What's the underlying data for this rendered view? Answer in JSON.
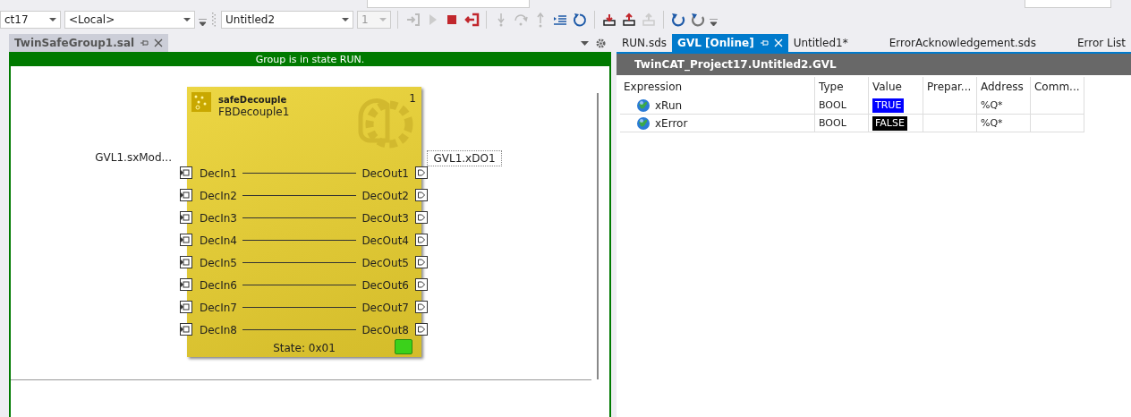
{
  "toolbar": {
    "combos": [
      {
        "value": "ct17",
        "disabled": false
      },
      {
        "value": "<Local>",
        "disabled": false
      },
      {
        "value": "Untitled2",
        "disabled": false
      },
      {
        "value": "1",
        "disabled": true
      }
    ]
  },
  "left_panel": {
    "tab": {
      "label": "TwinSafeGroup1.sal",
      "selected": true
    },
    "status": "Group is in state RUN.",
    "block": {
      "type": "safeDecouple",
      "instance": "FBDecouple1",
      "number": "1",
      "state": "State: 0x01",
      "inputs": [
        {
          "label": "DecIn1",
          "connection": "GVL1.sxMod..."
        },
        {
          "label": "DecIn2"
        },
        {
          "label": "DecIn3"
        },
        {
          "label": "DecIn4"
        },
        {
          "label": "DecIn5"
        },
        {
          "label": "DecIn6"
        },
        {
          "label": "DecIn7"
        },
        {
          "label": "DecIn8"
        }
      ],
      "outputs": [
        {
          "label": "DecOut1",
          "connection": "GVL1.xDO1"
        },
        {
          "label": "DecOut2"
        },
        {
          "label": "DecOut3"
        },
        {
          "label": "DecOut4"
        },
        {
          "label": "DecOut5"
        },
        {
          "label": "DecOut6"
        },
        {
          "label": "DecOut7"
        },
        {
          "label": "DecOut8"
        }
      ]
    }
  },
  "right_panel": {
    "tabs": [
      {
        "label": "RUN.sds",
        "selected": false
      },
      {
        "label": "GVL [Online]",
        "selected": true
      },
      {
        "label": "Untitled1*",
        "selected": false
      },
      {
        "label": "ErrorAcknowledgement.sds",
        "selected": false
      },
      {
        "label": "Error List",
        "selected": false
      }
    ],
    "header": "TwinCAT_Project17.Untitled2.GVL",
    "table": {
      "columns": [
        "Expression",
        "Type",
        "Value",
        "Prepar...",
        "Address",
        "Comm..."
      ],
      "rows": [
        {
          "expression": "xRun",
          "type": "BOOL",
          "value": "TRUE",
          "color": "#0000ff",
          "address": "%Q*"
        },
        {
          "expression": "xError",
          "type": "BOOL",
          "value": "FALSE",
          "color": "#000000",
          "address": "%Q*"
        }
      ]
    }
  }
}
